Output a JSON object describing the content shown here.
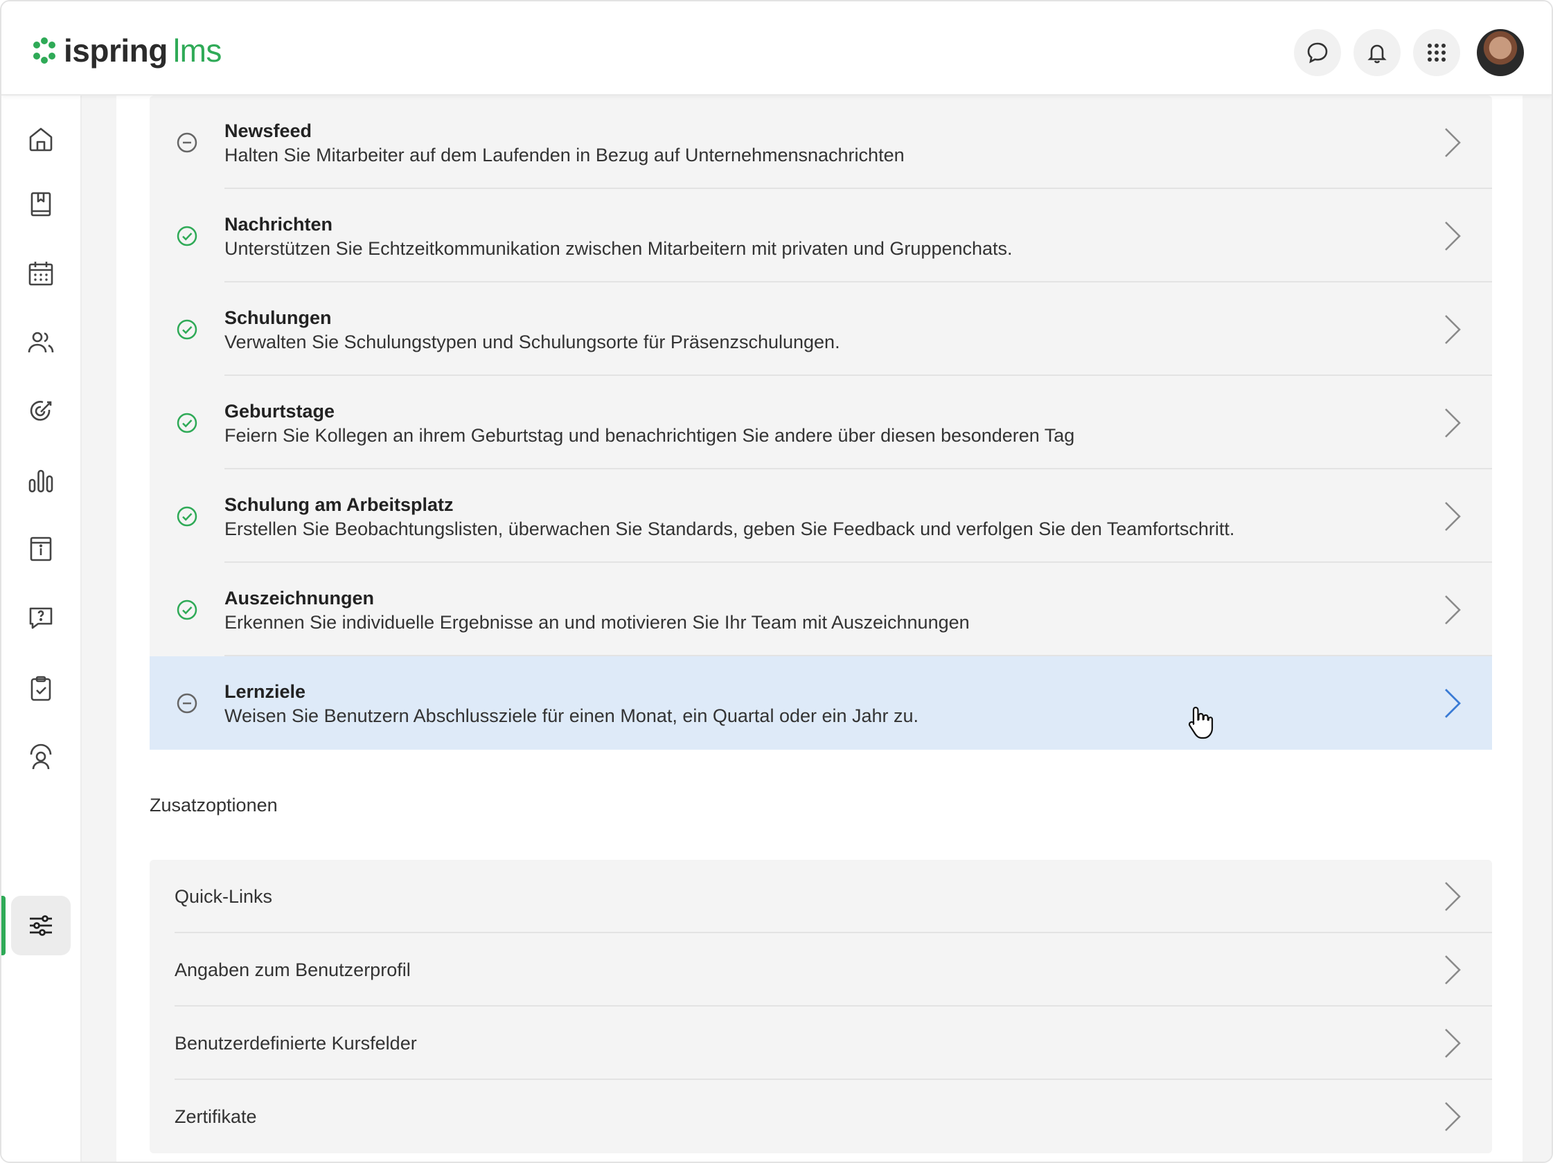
{
  "header": {
    "logo_text": "ispring",
    "logo_suffix": "lms",
    "icons": [
      "chat-icon",
      "bell-icon",
      "apps-grid-icon",
      "user-avatar"
    ]
  },
  "sidebar": {
    "items": [
      {
        "name": "home-icon",
        "active": false
      },
      {
        "name": "courses-book-icon",
        "active": false
      },
      {
        "name": "calendar-icon",
        "active": false
      },
      {
        "name": "users-icon",
        "active": false
      },
      {
        "name": "goals-target-icon",
        "active": false
      },
      {
        "name": "reports-chart-icon",
        "active": false
      },
      {
        "name": "info-page-icon",
        "active": false
      },
      {
        "name": "help-chat-icon",
        "active": false
      },
      {
        "name": "tasks-clipboard-icon",
        "active": false
      },
      {
        "name": "training-user-icon",
        "active": false
      },
      {
        "name": "settings-sliders-icon",
        "active": true
      }
    ]
  },
  "modules": [
    {
      "title": "Newsfeed",
      "description": "Halten Sie Mitarbeiter auf dem Laufenden in Bezug auf Unternehmensnachrichten",
      "status": "disabled"
    },
    {
      "title": "Nachrichten",
      "description": "Unterstützen Sie Echtzeitkommunikation zwischen Mitarbeitern mit privaten und Gruppenchats.",
      "status": "enabled"
    },
    {
      "title": "Schulungen",
      "description": "Verwalten Sie Schulungstypen und Schulungsorte für Präsenzschulungen.",
      "status": "enabled"
    },
    {
      "title": "Geburtstage",
      "description": "Feiern Sie Kollegen an ihrem Geburtstag und benachrichtigen Sie andere über diesen besonderen Tag",
      "status": "enabled"
    },
    {
      "title": "Schulung am Arbeitsplatz",
      "description": "Erstellen Sie Beobachtungslisten, überwachen Sie Standards, geben Sie Feedback und verfolgen Sie den Teamfortschritt.",
      "status": "enabled"
    },
    {
      "title": "Auszeichnungen",
      "description": "Erkennen Sie individuelle Ergebnisse an und motivieren Sie Ihr Team mit Auszeichnungen",
      "status": "enabled"
    },
    {
      "title": "Lernziele",
      "description": "Weisen Sie Benutzern Abschlussziele für einen Monat, ein Quartal oder ein Jahr zu.",
      "status": "disabled",
      "hovered": true
    }
  ],
  "extra_section": {
    "label": "Zusatzoptionen",
    "items": [
      "Quick-Links",
      "Angaben zum Benutzerprofil",
      "Benutzerdefinierte Kursfelder",
      "Zertifikate"
    ]
  },
  "colors": {
    "accent_green": "#2faa57",
    "hover_blue": "#deeaf8",
    "chevron_active": "#3a7bd5",
    "chevron_default": "#8a8a8a"
  }
}
